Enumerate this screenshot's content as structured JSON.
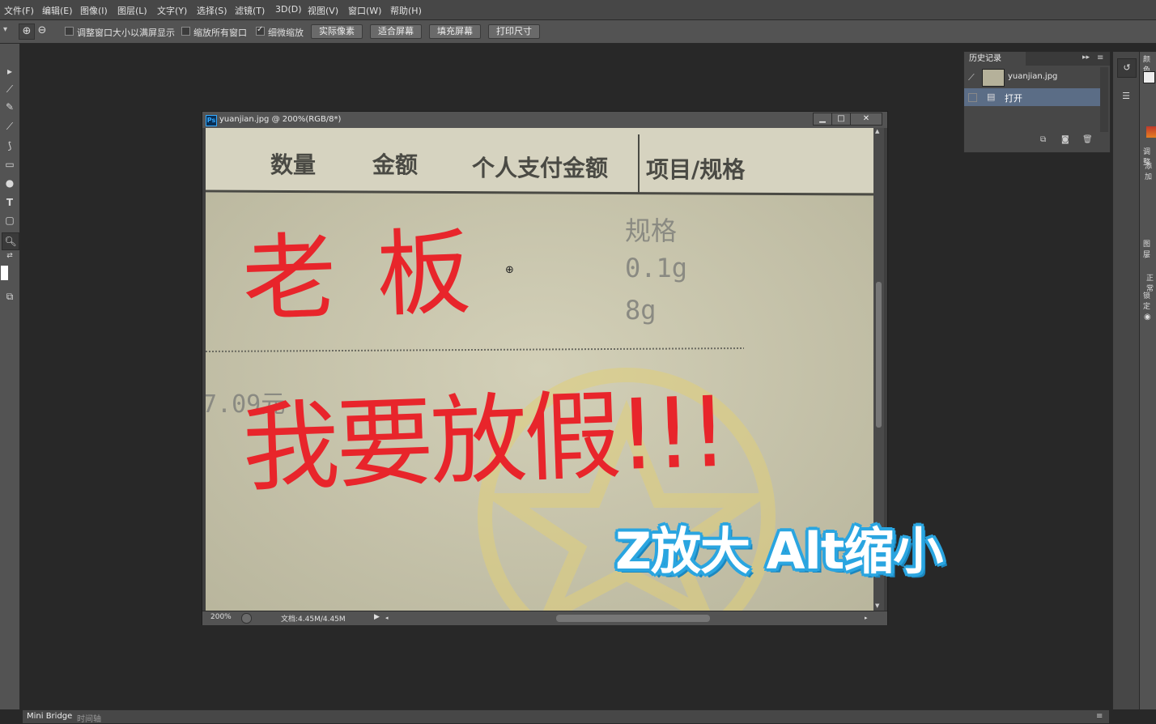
{
  "menu": {
    "items": [
      "文件(F)",
      "编辑(E)",
      "图像(I)",
      "图层(L)",
      "文字(Y)",
      "选择(S)",
      "滤镜(T)",
      "3D(D)",
      "视图(V)",
      "窗口(W)",
      "帮助(H)"
    ]
  },
  "options": {
    "checkbox_resize": "调整窗口大小以满屏显示",
    "checkbox_resize_checked": false,
    "checkbox_all": "缩放所有窗口",
    "checkbox_all_checked": false,
    "checkbox_scrubby": "细微缩放",
    "checkbox_scrubby_checked": true,
    "btn_actual": "实际像素",
    "btn_fit": "适合屏幕",
    "btn_fill": "填充屏幕",
    "btn_print": "打印尺寸"
  },
  "document": {
    "title": "yuanjian.jpg @ 200%(RGB/8*)",
    "ps_badge": "Ps",
    "zoom": "200%",
    "doc_size": "文档:4.45M/4.45M",
    "receipt": {
      "header": [
        "数量",
        "金额",
        "个人支付金额",
        "项目/规格"
      ],
      "spec_label": "规格",
      "spec_values": [
        "0.1g",
        "8g"
      ],
      "amount_fragment": "7.09元"
    },
    "handwriting": {
      "line1": "老板",
      "line2": "我要放假!!!"
    }
  },
  "history": {
    "tab": "历史记录",
    "snapshot": "yuanjian.jpg",
    "steps": [
      "打开"
    ]
  },
  "right_dock": {
    "labels": [
      "颜色",
      "调整",
      "添加",
      "图层",
      "正常",
      "锁定"
    ]
  },
  "bottom": {
    "tabs": [
      "Mini Bridge",
      "时间轴"
    ]
  },
  "caption": "Z放大 Alt缩小",
  "colors": {
    "ink_red": "#e8252b",
    "caption_blue": "#2aa5e0",
    "paper": "#c9c6ad"
  }
}
